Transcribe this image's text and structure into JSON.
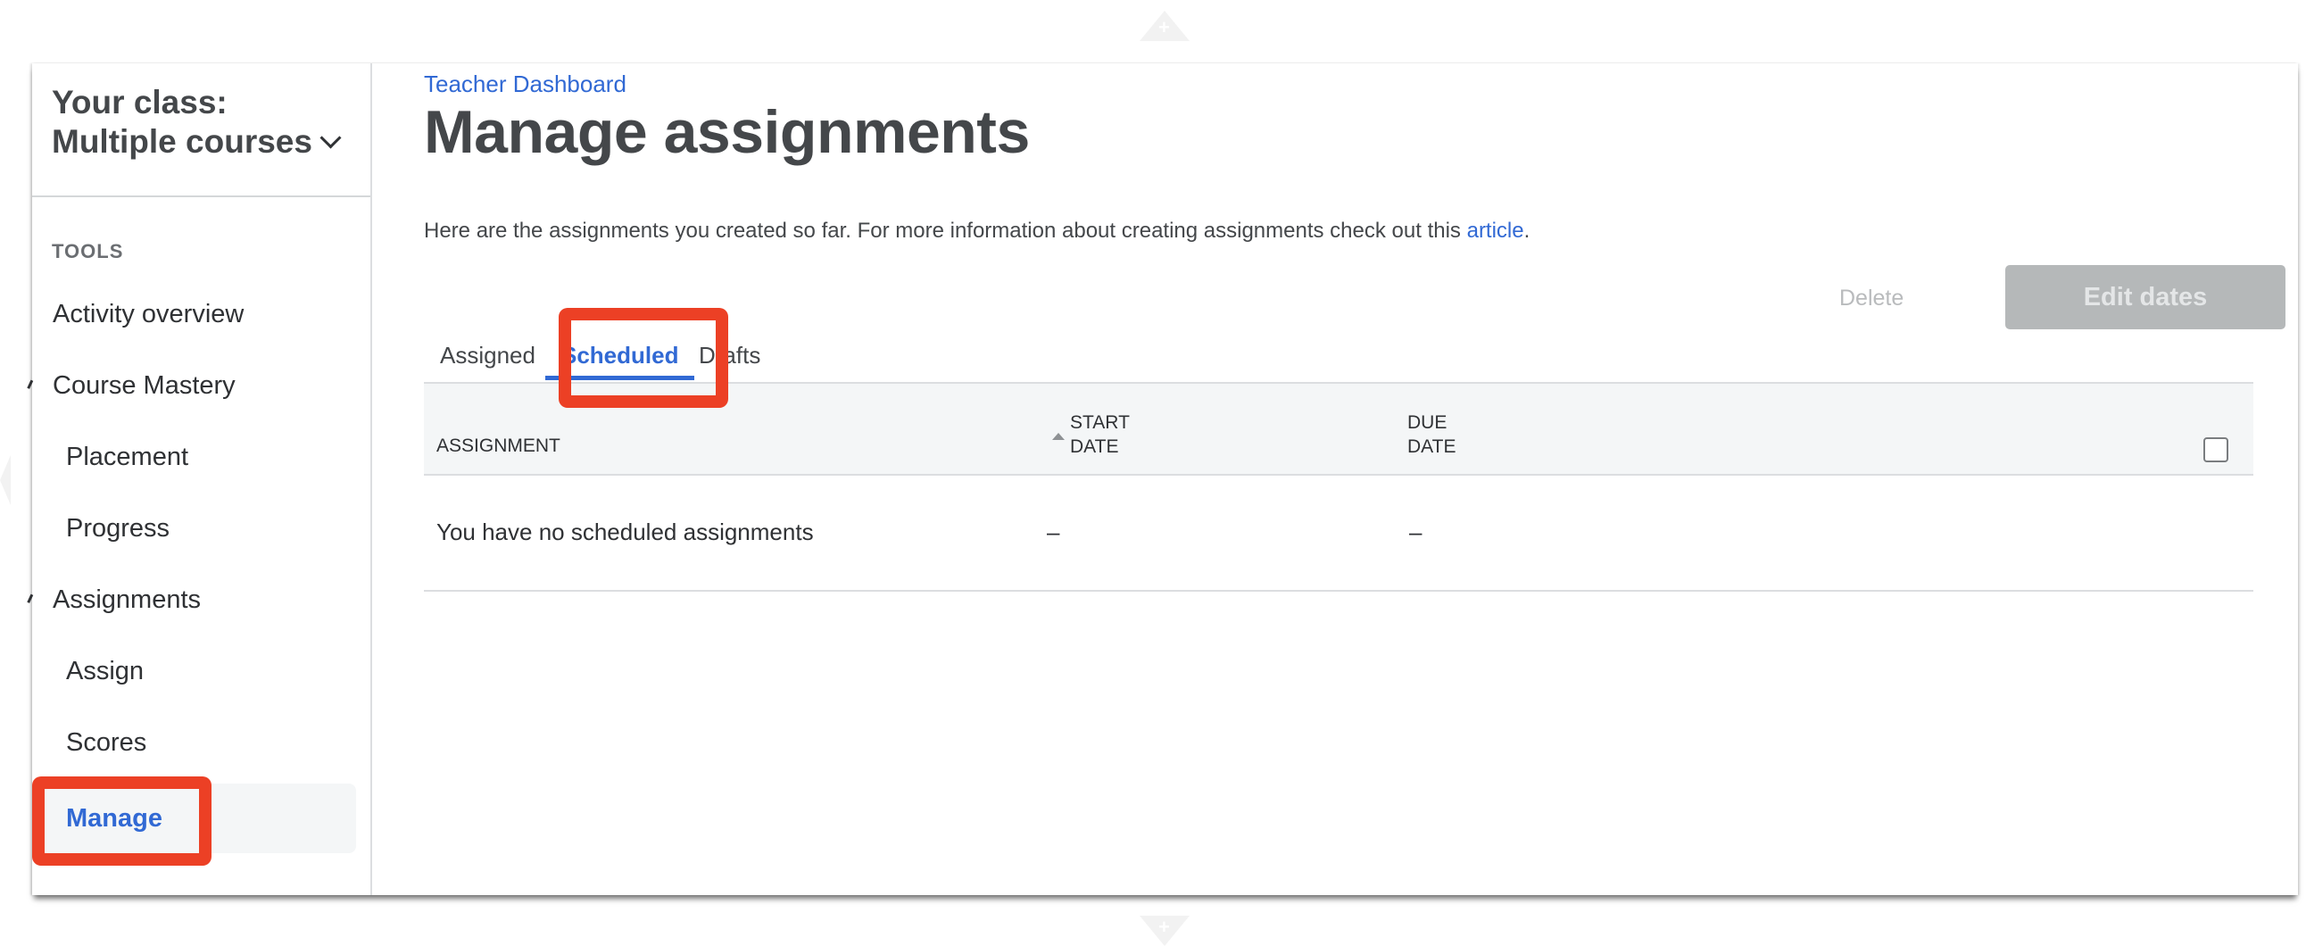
{
  "sidebar": {
    "class_selector": "Your class: Multiple courses",
    "section_label": "TOOLS",
    "items": [
      {
        "label": "Activity overview",
        "level": 1
      },
      {
        "label": "Course Mastery",
        "level": 1,
        "expanded": true
      },
      {
        "label": "Placement",
        "level": 2
      },
      {
        "label": "Progress",
        "level": 2
      },
      {
        "label": "Assignments",
        "level": 1,
        "expanded": true
      },
      {
        "label": "Assign",
        "level": 2
      },
      {
        "label": "Scores",
        "level": 2
      },
      {
        "label": "Manage",
        "level": 2,
        "active": true
      }
    ]
  },
  "main": {
    "breadcrumb": "Teacher Dashboard",
    "title": "Manage assignments",
    "description_prefix": "Here are the assignments you created so far. For more information about creating assignments check out this ",
    "description_link": "article",
    "description_suffix": ".",
    "actions": {
      "delete_label": "Delete",
      "edit_dates_label": "Edit dates"
    },
    "tabs": [
      {
        "label": "Assigned",
        "active": false
      },
      {
        "label": "Scheduled",
        "active": true
      },
      {
        "label": "Drafts",
        "active": false
      }
    ],
    "table": {
      "columns": [
        {
          "label": "ASSIGNMENT"
        },
        {
          "label_line1": "START",
          "label_line2": "DATE",
          "sorted": "ascending"
        },
        {
          "label_line1": "DUE",
          "label_line2": "DATE"
        }
      ],
      "select_all_checked": false,
      "rows": [
        {
          "assignment": "You have no scheduled assignments",
          "start_date": "–",
          "due_date": "–"
        }
      ]
    }
  },
  "colors": {
    "accent": "#3169d4",
    "highlight": "#ec4025",
    "disabled_button": "#b5b8b9"
  }
}
